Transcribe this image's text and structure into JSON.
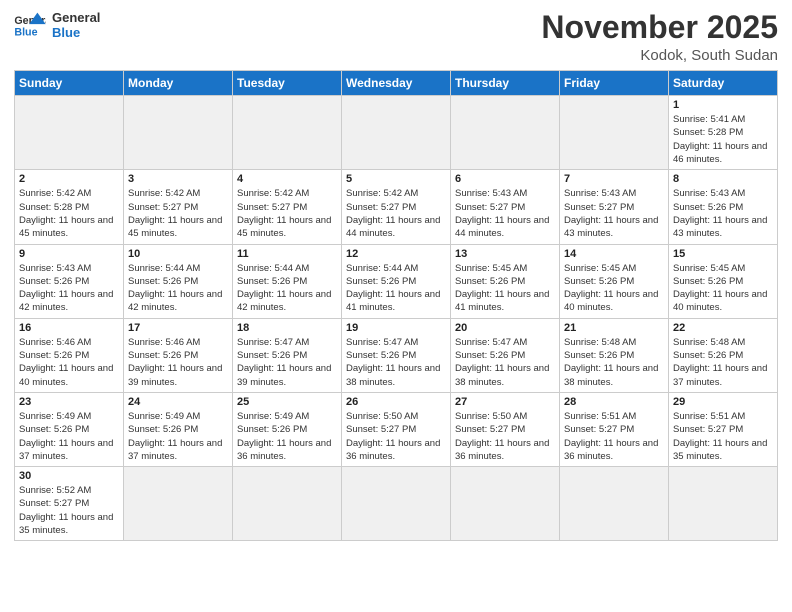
{
  "header": {
    "logo_general": "General",
    "logo_blue": "Blue",
    "month_title": "November 2025",
    "location": "Kodok, South Sudan"
  },
  "weekdays": [
    "Sunday",
    "Monday",
    "Tuesday",
    "Wednesday",
    "Thursday",
    "Friday",
    "Saturday"
  ],
  "weeks": [
    [
      {
        "day": "",
        "info": "",
        "empty": true
      },
      {
        "day": "",
        "info": "",
        "empty": true
      },
      {
        "day": "",
        "info": "",
        "empty": true
      },
      {
        "day": "",
        "info": "",
        "empty": true
      },
      {
        "day": "",
        "info": "",
        "empty": true
      },
      {
        "day": "",
        "info": "",
        "empty": true
      },
      {
        "day": "1",
        "info": "Sunrise: 5:41 AM\nSunset: 5:28 PM\nDaylight: 11 hours\nand 46 minutes."
      }
    ],
    [
      {
        "day": "2",
        "info": "Sunrise: 5:42 AM\nSunset: 5:28 PM\nDaylight: 11 hours\nand 45 minutes."
      },
      {
        "day": "3",
        "info": "Sunrise: 5:42 AM\nSunset: 5:27 PM\nDaylight: 11 hours\nand 45 minutes."
      },
      {
        "day": "4",
        "info": "Sunrise: 5:42 AM\nSunset: 5:27 PM\nDaylight: 11 hours\nand 45 minutes."
      },
      {
        "day": "5",
        "info": "Sunrise: 5:42 AM\nSunset: 5:27 PM\nDaylight: 11 hours\nand 44 minutes."
      },
      {
        "day": "6",
        "info": "Sunrise: 5:43 AM\nSunset: 5:27 PM\nDaylight: 11 hours\nand 44 minutes."
      },
      {
        "day": "7",
        "info": "Sunrise: 5:43 AM\nSunset: 5:27 PM\nDaylight: 11 hours\nand 43 minutes."
      },
      {
        "day": "8",
        "info": "Sunrise: 5:43 AM\nSunset: 5:26 PM\nDaylight: 11 hours\nand 43 minutes."
      }
    ],
    [
      {
        "day": "9",
        "info": "Sunrise: 5:43 AM\nSunset: 5:26 PM\nDaylight: 11 hours\nand 42 minutes."
      },
      {
        "day": "10",
        "info": "Sunrise: 5:44 AM\nSunset: 5:26 PM\nDaylight: 11 hours\nand 42 minutes."
      },
      {
        "day": "11",
        "info": "Sunrise: 5:44 AM\nSunset: 5:26 PM\nDaylight: 11 hours\nand 42 minutes."
      },
      {
        "day": "12",
        "info": "Sunrise: 5:44 AM\nSunset: 5:26 PM\nDaylight: 11 hours\nand 41 minutes."
      },
      {
        "day": "13",
        "info": "Sunrise: 5:45 AM\nSunset: 5:26 PM\nDaylight: 11 hours\nand 41 minutes."
      },
      {
        "day": "14",
        "info": "Sunrise: 5:45 AM\nSunset: 5:26 PM\nDaylight: 11 hours\nand 40 minutes."
      },
      {
        "day": "15",
        "info": "Sunrise: 5:45 AM\nSunset: 5:26 PM\nDaylight: 11 hours\nand 40 minutes."
      }
    ],
    [
      {
        "day": "16",
        "info": "Sunrise: 5:46 AM\nSunset: 5:26 PM\nDaylight: 11 hours\nand 40 minutes."
      },
      {
        "day": "17",
        "info": "Sunrise: 5:46 AM\nSunset: 5:26 PM\nDaylight: 11 hours\nand 39 minutes."
      },
      {
        "day": "18",
        "info": "Sunrise: 5:47 AM\nSunset: 5:26 PM\nDaylight: 11 hours\nand 39 minutes."
      },
      {
        "day": "19",
        "info": "Sunrise: 5:47 AM\nSunset: 5:26 PM\nDaylight: 11 hours\nand 38 minutes."
      },
      {
        "day": "20",
        "info": "Sunrise: 5:47 AM\nSunset: 5:26 PM\nDaylight: 11 hours\nand 38 minutes."
      },
      {
        "day": "21",
        "info": "Sunrise: 5:48 AM\nSunset: 5:26 PM\nDaylight: 11 hours\nand 38 minutes."
      },
      {
        "day": "22",
        "info": "Sunrise: 5:48 AM\nSunset: 5:26 PM\nDaylight: 11 hours\nand 37 minutes."
      }
    ],
    [
      {
        "day": "23",
        "info": "Sunrise: 5:49 AM\nSunset: 5:26 PM\nDaylight: 11 hours\nand 37 minutes."
      },
      {
        "day": "24",
        "info": "Sunrise: 5:49 AM\nSunset: 5:26 PM\nDaylight: 11 hours\nand 37 minutes."
      },
      {
        "day": "25",
        "info": "Sunrise: 5:49 AM\nSunset: 5:26 PM\nDaylight: 11 hours\nand 36 minutes."
      },
      {
        "day": "26",
        "info": "Sunrise: 5:50 AM\nSunset: 5:27 PM\nDaylight: 11 hours\nand 36 minutes."
      },
      {
        "day": "27",
        "info": "Sunrise: 5:50 AM\nSunset: 5:27 PM\nDaylight: 11 hours\nand 36 minutes."
      },
      {
        "day": "28",
        "info": "Sunrise: 5:51 AM\nSunset: 5:27 PM\nDaylight: 11 hours\nand 36 minutes."
      },
      {
        "day": "29",
        "info": "Sunrise: 5:51 AM\nSunset: 5:27 PM\nDaylight: 11 hours\nand 35 minutes."
      }
    ],
    [
      {
        "day": "30",
        "info": "Sunrise: 5:52 AM\nSunset: 5:27 PM\nDaylight: 11 hours\nand 35 minutes."
      },
      {
        "day": "",
        "info": "",
        "empty": true
      },
      {
        "day": "",
        "info": "",
        "empty": true
      },
      {
        "day": "",
        "info": "",
        "empty": true
      },
      {
        "day": "",
        "info": "",
        "empty": true
      },
      {
        "day": "",
        "info": "",
        "empty": true
      },
      {
        "day": "",
        "info": "",
        "empty": true
      }
    ]
  ]
}
